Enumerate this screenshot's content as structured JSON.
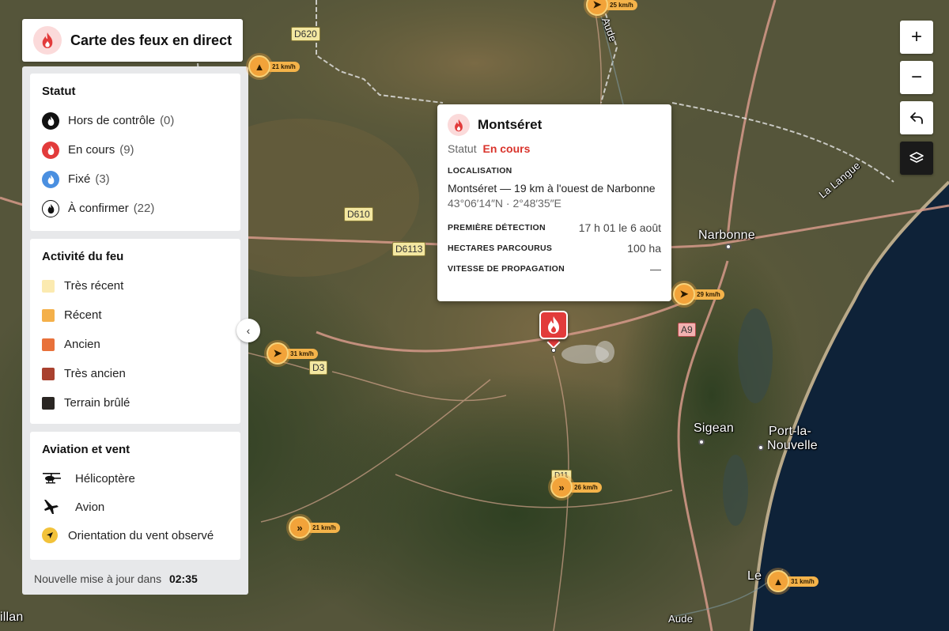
{
  "header": {
    "title": "Carte des feux en direct"
  },
  "status_section": {
    "title": "Statut",
    "items": [
      {
        "label": "Hors de contrôle",
        "count": "(0)",
        "color": "#111111"
      },
      {
        "label": "En cours",
        "count": "(9)",
        "color": "#e23b3b"
      },
      {
        "label": "Fixé",
        "count": "(3)",
        "color": "#4a8fe0"
      },
      {
        "label": "À confirmer",
        "count": "(22)",
        "color": "#ffffff"
      }
    ]
  },
  "activity_section": {
    "title": "Activité du feu",
    "items": [
      {
        "label": "Très récent",
        "color": "#fbeab0"
      },
      {
        "label": "Récent",
        "color": "#f4b04a"
      },
      {
        "label": "Ancien",
        "color": "#e8713a"
      },
      {
        "label": "Très ancien",
        "color": "#a9412f"
      },
      {
        "label": "Terrain brûlé",
        "color": "#2a2623"
      }
    ]
  },
  "aviation_section": {
    "title": "Aviation et vent",
    "items": [
      {
        "label": "Hélicoptère",
        "icon": "helicopter-icon"
      },
      {
        "label": "Avion",
        "icon": "airplane-icon"
      },
      {
        "label": "Orientation du vent observé",
        "icon": "wind-direction-icon"
      }
    ]
  },
  "update": {
    "label": "Nouvelle mise à jour dans",
    "time": "02:35"
  },
  "popup": {
    "title": "Montséret",
    "status_label": "Statut",
    "status_value": "En cours",
    "location_label": "LOCALISATION",
    "location": "Montséret — 19 km à l'ouest de Narbonne",
    "coords": "43°06′14″N · 2°48′35″E",
    "first_detection_label": "PREMIÈRE DÉTECTION",
    "first_detection": "17 h 01 le 6 août",
    "hectares_label": "HECTARES PARCOURUS",
    "hectares": "100 ha",
    "speed_label": "VITESSE DE PROPAGATION",
    "speed": "—"
  },
  "map": {
    "places": [
      "Narbonne",
      "Sigean",
      "Port-la-",
      "Nouvelle",
      "La Langue",
      "Le",
      "illan",
      "Aude",
      "Aude"
    ],
    "roads": [
      "D620",
      "D610",
      "D6113",
      "D3",
      "A9",
      "D11"
    ],
    "wind_markers": [
      "25 km/h",
      "21 km/h",
      "29 km/h",
      "31 km/h",
      "26 km/h",
      "21 km/h",
      "31 km/h"
    ]
  },
  "controls": {
    "zoom_in": "+",
    "zoom_out": "−",
    "collapse": "‹"
  }
}
